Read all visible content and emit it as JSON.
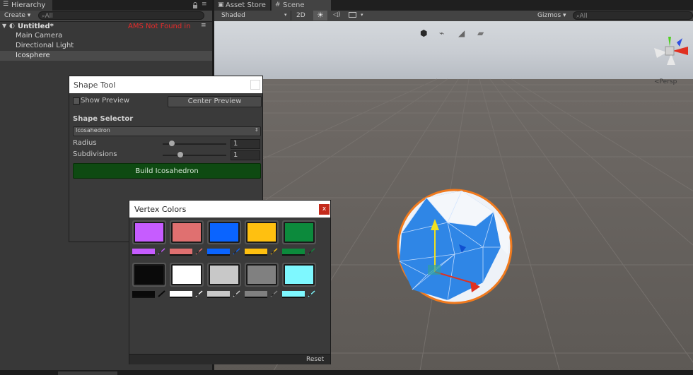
{
  "hierarchy": {
    "tab_label": "Hierarchy",
    "create_label": "Create ▾",
    "search_placeholder": "All",
    "scene_name": "Untitled*",
    "warning_text": "AMS Not Found in",
    "items": [
      "Main Camera",
      "Directional Light",
      "Icosphere"
    ]
  },
  "scene": {
    "tabs": [
      "Asset Store",
      "Scene"
    ],
    "shading_mode": "Shaded",
    "toggle_2d": "2D",
    "gizmos_label": "Gizmos ▾",
    "search_placeholder": "All",
    "persp_label": "<Persp"
  },
  "shape_tool": {
    "title": "Shape Tool",
    "show_preview_label": "Show Preview",
    "center_preview_label": "Center Preview",
    "selector_heading": "Shape Selector",
    "selected_shape": "Icosahedron",
    "radius_label": "Radius",
    "radius_value": "1",
    "subdivisions_label": "Subdivisions",
    "subdivisions_value": "1",
    "build_label": "Build Icosahedron"
  },
  "vertex_colors": {
    "title": "Vertex Colors",
    "close_label": "x",
    "reset_label": "Reset",
    "colors": [
      "#c65cff",
      "#e07070",
      "#0a64ff",
      "#ffc010",
      "#0c8a3c",
      "#0a0a0a",
      "#ffffff",
      "#c8c8c8",
      "#808080",
      "#7ef8ff"
    ]
  }
}
